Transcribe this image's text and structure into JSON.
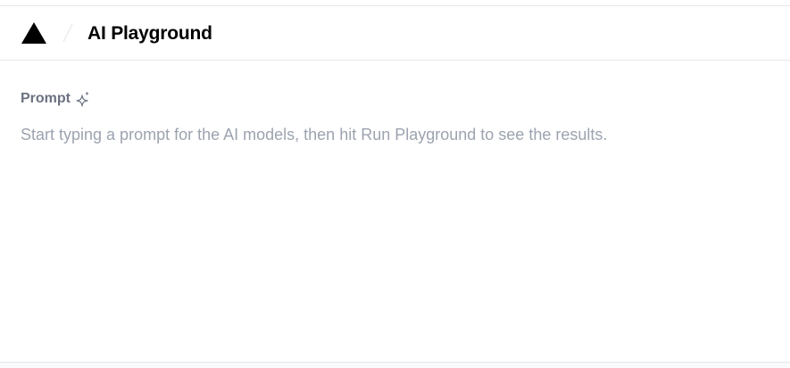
{
  "header": {
    "logo_icon": "vercel-triangle-icon",
    "separator_icon": "slash-separator-icon",
    "title": "AI Playground"
  },
  "prompt": {
    "label": "Prompt",
    "label_icon": "sparkle-icon",
    "placeholder": "Start typing a prompt for the AI models, then hit Run Playground to see the results.",
    "value": ""
  },
  "colors": {
    "border": "#e5e7eb",
    "label": "#6b7280",
    "placeholder": "#9ca3af",
    "title": "#000000"
  }
}
